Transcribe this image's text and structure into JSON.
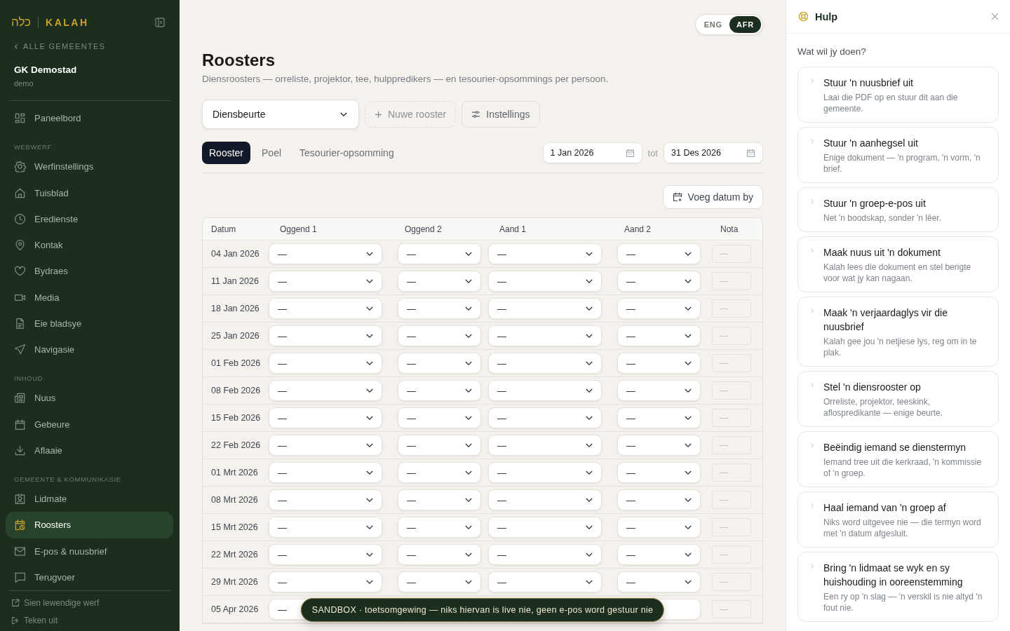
{
  "sidebar": {
    "logo_hebrew": "כלה",
    "logo_text": "KALAH",
    "back_link": "ALLE GEMEENTES",
    "congregation": {
      "name": "GK Demostad",
      "slug": "demo"
    },
    "groups": [
      {
        "items": [
          {
            "label": "Paneelbord",
            "selected": false
          }
        ]
      },
      {
        "heading": "WEBWERF",
        "items": [
          {
            "label": "Werfinstellings",
            "selected": false
          },
          {
            "label": "Tuisblad",
            "selected": false
          },
          {
            "label": "Eredienste",
            "selected": false
          },
          {
            "label": "Kontak",
            "selected": false
          },
          {
            "label": "Bydraes",
            "selected": false
          },
          {
            "label": "Media",
            "selected": false
          },
          {
            "label": "Eie bladsye",
            "selected": false
          },
          {
            "label": "Navigasie",
            "selected": false
          }
        ]
      },
      {
        "heading": "INHOUD",
        "items": [
          {
            "label": "Nuus",
            "selected": false
          },
          {
            "label": "Gebeure",
            "selected": false
          },
          {
            "label": "Aflaaie",
            "selected": false
          }
        ]
      },
      {
        "heading": "GEMEENTE & KOMMUNIKASIE",
        "items": [
          {
            "label": "Lidmate",
            "selected": false
          },
          {
            "label": "Roosters",
            "selected": true
          },
          {
            "label": "E-pos & nuusbrief",
            "selected": false
          },
          {
            "label": "Terugvoer",
            "selected": false
          }
        ]
      }
    ],
    "footer": [
      {
        "label": "Sien lewendige werf"
      },
      {
        "label": "Teken uit"
      }
    ]
  },
  "languages": [
    {
      "label": "ENG",
      "selected": false
    },
    {
      "label": "AFR",
      "selected": true
    }
  ],
  "page": {
    "title": "Roosters",
    "subtitle": "Diensroosters — orreliste, projektor, tee, hulppredikers — en tesourier-opsommings per persoon."
  },
  "toolbar": {
    "roster_select": "Diensbeurte",
    "new_button": "Nuwe rooster",
    "settings_button": "Instellings"
  },
  "tabs": [
    {
      "label": "Rooster",
      "selected": true
    },
    {
      "label": "Poel",
      "selected": false
    },
    {
      "label": "Tesourier-opsomming",
      "selected": false
    }
  ],
  "date_range": {
    "from": "1 Jan 2026",
    "separator": "tot",
    "to": "31 Des 2026"
  },
  "add_date_button": "Voeg datum by",
  "table": {
    "columns": [
      "Datum",
      "Oggend 1",
      "Oggend 2",
      "Aand 1",
      "Aand 2",
      "Nota"
    ],
    "rows": [
      {
        "date": "04 Jan 2026",
        "slots": [
          "—",
          "—",
          "—",
          "—"
        ],
        "note_placeholder": "—"
      },
      {
        "date": "11 Jan 2026",
        "slots": [
          "—",
          "—",
          "—",
          "—"
        ],
        "note_placeholder": "—"
      },
      {
        "date": "18 Jan 2026",
        "slots": [
          "—",
          "—",
          "—",
          "—"
        ],
        "note_placeholder": "—"
      },
      {
        "date": "25 Jan 2026",
        "slots": [
          "—",
          "—",
          "—",
          "—"
        ],
        "note_placeholder": "—"
      },
      {
        "date": "01 Feb 2026",
        "slots": [
          "—",
          "—",
          "—",
          "—"
        ],
        "note_placeholder": "—"
      },
      {
        "date": "08 Feb 2026",
        "slots": [
          "—",
          "—",
          "—",
          "—"
        ],
        "note_placeholder": "—"
      },
      {
        "date": "15 Feb 2026",
        "slots": [
          "—",
          "—",
          "—",
          "—"
        ],
        "note_placeholder": "—"
      },
      {
        "date": "22 Feb 2026",
        "slots": [
          "—",
          "—",
          "—",
          "—"
        ],
        "note_placeholder": "—"
      },
      {
        "date": "01 Mrt 2026",
        "slots": [
          "—",
          "—",
          "—",
          "—"
        ],
        "note_placeholder": "—"
      },
      {
        "date": "08 Mrt 2026",
        "slots": [
          "—",
          "—",
          "—",
          "—"
        ],
        "note_placeholder": "—"
      },
      {
        "date": "15 Mrt 2026",
        "slots": [
          "—",
          "—",
          "—",
          "—"
        ],
        "note_placeholder": "—"
      },
      {
        "date": "22 Mrt 2026",
        "slots": [
          "—",
          "—",
          "—",
          "—"
        ],
        "note_placeholder": "—"
      },
      {
        "date": "29 Mrt 2026",
        "slots": [
          "—",
          "—",
          "—",
          "—"
        ],
        "note_placeholder": "—"
      },
      {
        "date": "05 Apr 2026",
        "slots": [
          "—"
        ],
        "note_placeholder": "—"
      }
    ]
  },
  "sandbox_banner": "SANDBOX · toetsomgewing — niks hiervan is live nie, geen e-pos word gestuur nie",
  "help": {
    "title": "Hulp",
    "prompt": "Wat wil jy doen?",
    "cards": [
      {
        "title": "Stuur 'n nuusbrief uit",
        "description": "Laai die PDF op en stuur dit aan die gemeente."
      },
      {
        "title": "Stuur 'n aanhegsel uit",
        "description": "Enige dokument — 'n program, 'n vorm, 'n brief."
      },
      {
        "title": "Stuur 'n groep-e-pos uit",
        "description": "Net 'n boodskap, sonder 'n lêer."
      },
      {
        "title": "Maak nuus uit 'n dokument",
        "description": "Kalah lees die dokument en stel berigte voor wat jy kan nagaan."
      },
      {
        "title": "Maak 'n verjaardaglys vir die nuusbrief",
        "description": "Kalah gee jou 'n netjiese lys, reg om in te plak."
      },
      {
        "title": "Stel 'n diensrooster op",
        "description": "Orreliste, projektor, teeskink, aflospredikante — enige beurte."
      },
      {
        "title": "Beëindig iemand se dienstermyn",
        "description": "Iemand tree uit die kerkraad, 'n kommissie of 'n groep."
      },
      {
        "title": "Haal iemand van 'n groep af",
        "description": "Niks word uitgevee nie — die termyn word met 'n datum afgesluit."
      },
      {
        "title": "Bring 'n lidmaat se wyk en sy huishouding in ooreenstemming",
        "description": "Een ry op 'n slag — 'n verskil is nie altyd 'n fout nie."
      }
    ]
  }
}
